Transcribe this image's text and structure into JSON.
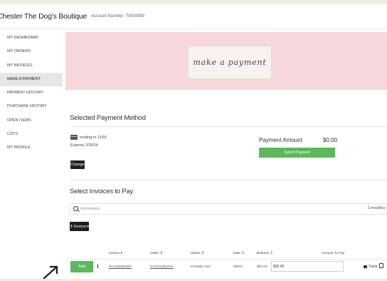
{
  "header": {
    "store_name": "Chester The Dog's Boutique",
    "account_number": "Account Number: 70000099"
  },
  "sidebar": {
    "items": [
      {
        "label": "MY DASHBOARD"
      },
      {
        "label": "MY ORDERS"
      },
      {
        "label": "MY INVOICES"
      },
      {
        "label": "MAKE A PAYMENT",
        "active": true
      },
      {
        "label": "PAYMENT HISTORY"
      },
      {
        "label": "PURCHASE HISTORY"
      },
      {
        "label": "OPEN ITEMS"
      },
      {
        "label": "LISTS"
      },
      {
        "label": "MY PROFILE"
      }
    ]
  },
  "banner": {
    "text": "make a payment"
  },
  "payment_method": {
    "title": "Selected Payment Method",
    "card_ending": "ending in 1109",
    "expires": "Expires 2/2024",
    "change_label": "Change"
  },
  "payment_amount": {
    "label": "Payment Amount",
    "value": "$0.00",
    "submit_label": "Submit Payment"
  },
  "invoices": {
    "title": "Select Invoices to Pay",
    "search_placeholder": "Find invoice...",
    "results": "1 result(s)",
    "filter_label": "Invoice",
    "columns": {
      "invoice": "Invoice",
      "order": "Order",
      "status": "Status",
      "date": "Date",
      "balance": "Balance",
      "amount_to_pay": "Amount To Pay"
    },
    "rows": [
      {
        "add_label": "Add",
        "invoice": "6TL000352967",
        "order": "6TL00145187A",
        "status": "Partially Paid",
        "date": "9/9/21",
        "balance": "$92.00",
        "amount_value": "$92.00",
        "track_label": "Track"
      }
    ]
  },
  "colors": {
    "banner_bg": "#f6d7dc",
    "accent_green": "#5cb85c",
    "page_bg": "#f1ebe6"
  }
}
